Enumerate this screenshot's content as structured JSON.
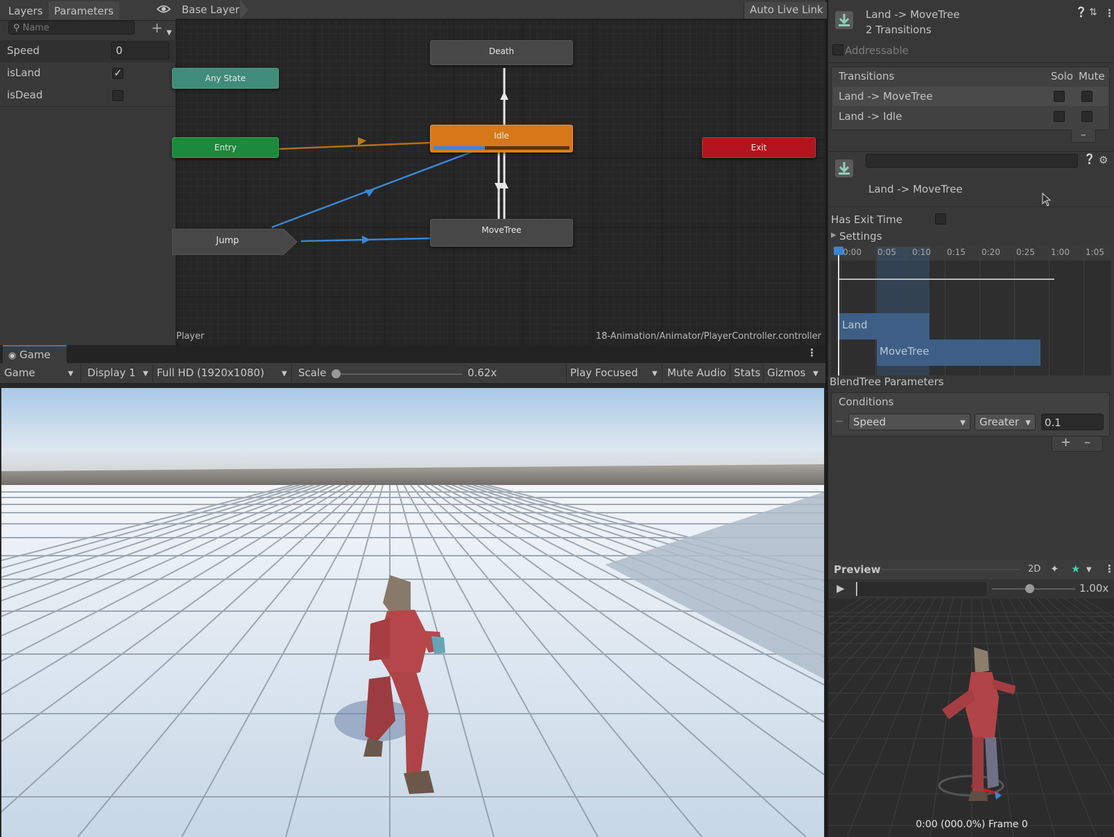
{
  "animator": {
    "tabs": [
      "Layers",
      "Parameters"
    ],
    "search_placeholder": "Name",
    "parameters": [
      {
        "name": "Speed",
        "value": "0"
      },
      {
        "name": "isLand",
        "checked": true
      },
      {
        "name": "isDead",
        "checked": false
      }
    ],
    "breadcrumb": "Base Layer",
    "auto_live_link": "Auto Live Link",
    "nodes": {
      "death": "Death",
      "any_state": "Any State",
      "idle": "Idle",
      "entry": "Entry",
      "exit": "Exit",
      "jump": "Jump",
      "move_tree": "MoveTree"
    },
    "idle_progress": 0.38,
    "footer_left": "Player",
    "footer_right": "18-Animation/Animator/PlayerController.controller"
  },
  "game": {
    "tab_label": "Game",
    "view_select": "Game",
    "display_select": "Display 1",
    "resolution_select": "Full HD (1920x1080)",
    "scale_label": "Scale",
    "scale_value": "0.62x",
    "play_focused": "Play Focused",
    "mute_audio": "Mute Audio",
    "stats": "Stats",
    "gizmos": "Gizmos"
  },
  "inspector": {
    "title": "Land -> MoveTree",
    "subtitle": "2 Transitions",
    "addressable": "Addressable",
    "transitions_header": "Transitions",
    "solo_header": "Solo",
    "mute_header": "Mute",
    "transitions": [
      {
        "label": "Land -> MoveTree"
      },
      {
        "label": "Land -> Idle"
      }
    ],
    "transition_name": "Land -> MoveTree",
    "has_exit_time": "Has Exit Time",
    "settings": "Settings",
    "timeline_ticks": [
      "0:00",
      "0:05",
      "0:10",
      "0:15",
      "0:20",
      "0:25",
      "1:00",
      "1:05"
    ],
    "track_from": "Land",
    "track_to": "MoveTree",
    "blend_params": "BlendTree Parameters",
    "conditions_header": "Conditions",
    "condition": {
      "parameter": "Speed",
      "mode": "Greater",
      "threshold": "0.1"
    }
  },
  "preview": {
    "title": "Preview",
    "mode_2d": "2D",
    "speed": "1.00x",
    "status": "0:00 (000.0%) Frame 0"
  }
}
